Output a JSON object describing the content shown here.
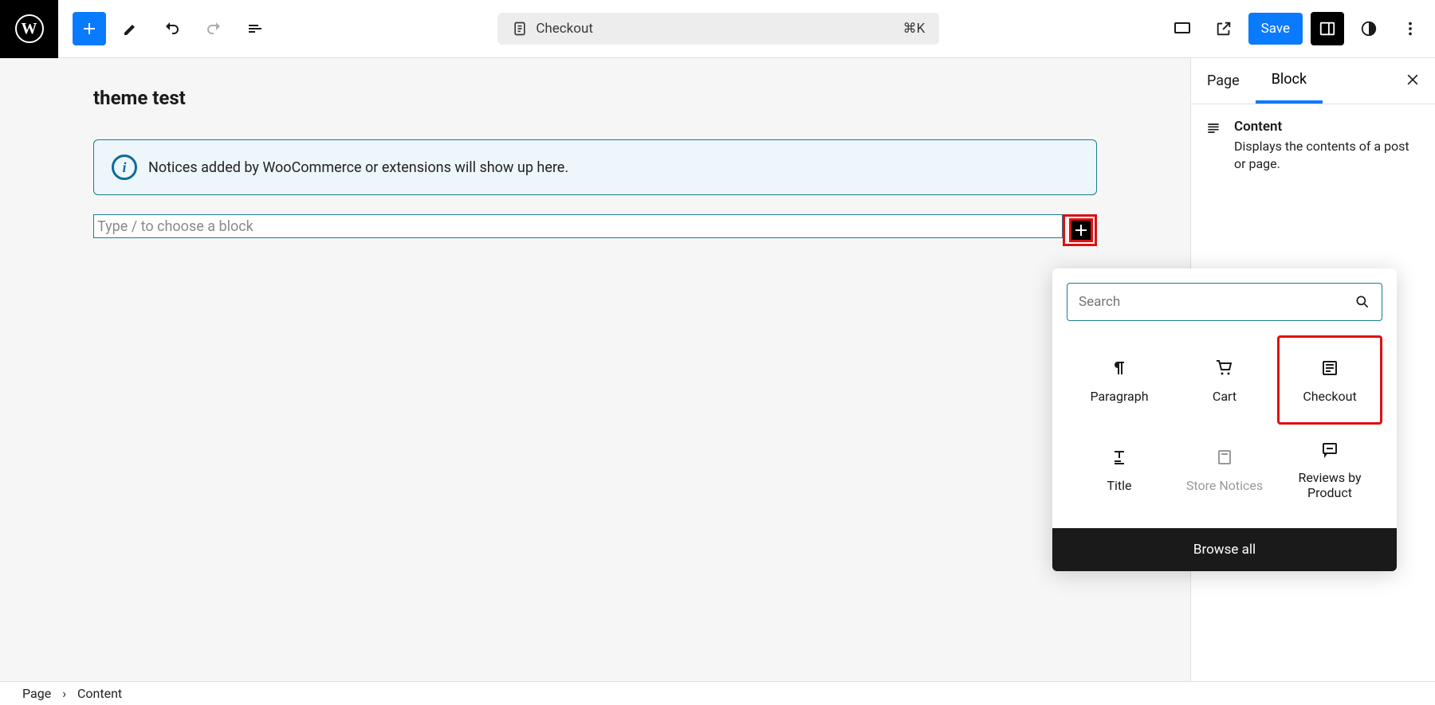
{
  "topbar": {
    "center_label": "Checkout",
    "shortcut": "⌘K",
    "save_label": "Save"
  },
  "page": {
    "title": "theme test"
  },
  "notice": {
    "text": "Notices added by WooCommerce or extensions will show up here."
  },
  "block_placeholder": "Type / to choose a block",
  "sidebar": {
    "tabs": {
      "page": "Page",
      "block": "Block"
    },
    "content_title": "Content",
    "content_desc": "Displays the contents of a post or page."
  },
  "popover": {
    "search_placeholder": "Search",
    "items": [
      {
        "label": "Paragraph"
      },
      {
        "label": "Cart"
      },
      {
        "label": "Checkout"
      },
      {
        "label": "Title"
      },
      {
        "label": "Store Notices"
      },
      {
        "label": "Reviews by Product"
      }
    ],
    "browse_label": "Browse all"
  },
  "footer": {
    "crumb1": "Page",
    "crumb2": "Content"
  }
}
